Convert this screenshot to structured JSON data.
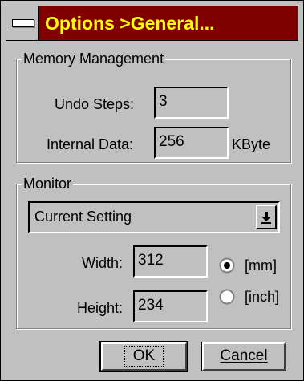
{
  "window": {
    "title": "Options >General..."
  },
  "memory": {
    "legend": "Memory Management",
    "undo_label": "Undo Steps:",
    "undo_value": "3",
    "internal_label": "Internal Data:",
    "internal_value": "256",
    "internal_unit": "KByte"
  },
  "monitor": {
    "legend": "Monitor",
    "setting_selected": "Current Setting",
    "width_label": "Width:",
    "width_value": "312",
    "height_label": "Height:",
    "height_value": "234",
    "unit_mm": "[mm]",
    "unit_inch": "[inch]",
    "selected_unit": "mm"
  },
  "buttons": {
    "ok": "OK",
    "cancel": "Cancel"
  },
  "icons": {
    "system_menu": "system-menu-icon",
    "dropdown": "dropdown-arrow-icon"
  }
}
